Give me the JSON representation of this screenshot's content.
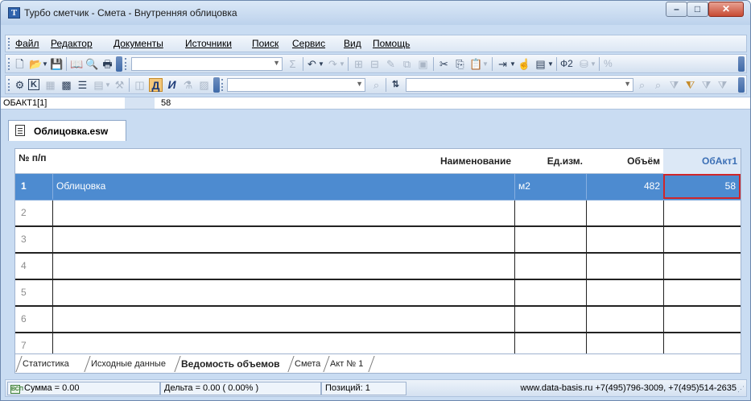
{
  "window": {
    "title": "Турбо сметчик - Смета - Внутренняя облицовка",
    "app_icon_letter": "T"
  },
  "menu": {
    "items": [
      "Файл",
      "Редактор",
      "Документы",
      "Источники",
      "Поиск",
      "Сервис",
      "Вид",
      "Помощь"
    ]
  },
  "toolbar": {
    "percent_label": "%",
    "phi2_label": "Ф2",
    "bold_letter": "Д",
    "italic_letter": "И",
    "k_letter": "K"
  },
  "refbar": {
    "cell_name": "ОБАКТ1[1]",
    "cell_value": "58"
  },
  "document_tab": {
    "label": "Облицовка.esw"
  },
  "grid": {
    "headers": {
      "num": "№ п/п",
      "name": "Наименование",
      "unit": "Ед.изм.",
      "volume": "Объём",
      "act": "ОбАкт1"
    },
    "rows": [
      {
        "num": "1",
        "name": "Облицовка",
        "unit": "м2",
        "volume": "482",
        "act": "58"
      },
      {
        "num": "2",
        "name": "",
        "unit": "",
        "volume": "",
        "act": ""
      },
      {
        "num": "3",
        "name": "",
        "unit": "",
        "volume": "",
        "act": ""
      },
      {
        "num": "4",
        "name": "",
        "unit": "",
        "volume": "",
        "act": ""
      },
      {
        "num": "5",
        "name": "",
        "unit": "",
        "volume": "",
        "act": ""
      },
      {
        "num": "6",
        "name": "",
        "unit": "",
        "volume": "",
        "act": ""
      },
      {
        "num": "7",
        "name": "",
        "unit": "",
        "volume": "",
        "act": ""
      }
    ]
  },
  "sheet_tabs": [
    "Статистика",
    "Исходные данные",
    "Ведомость объемов",
    "Смета",
    "Акт № 1"
  ],
  "status": {
    "sum": "Сумма = 0.00",
    "delta": "Дельта = 0.00 ( 0.00% )",
    "positions": "Позиций: 1",
    "contact": "www.data-basis.ru  +7(495)796-3009, +7(495)514-2635"
  },
  "colors": {
    "selection": "#4d8bd0",
    "active_cell_border": "#d0262a",
    "act_header": "#3b6fb5"
  }
}
